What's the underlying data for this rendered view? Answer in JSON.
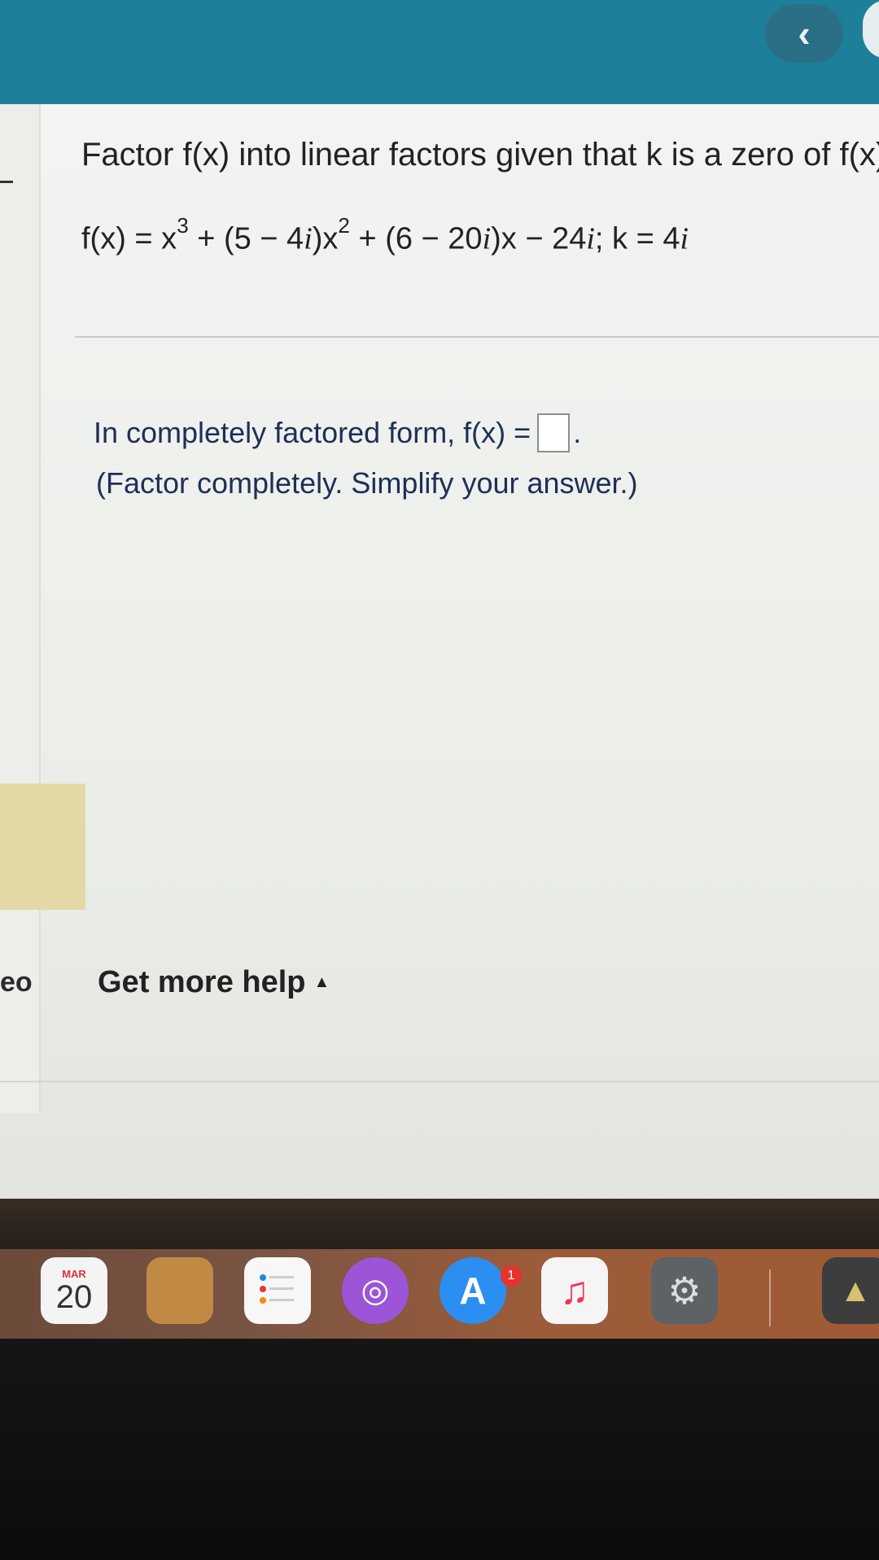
{
  "header": {
    "back_icon": "chevron-left-icon"
  },
  "problem": {
    "title": "Factor f(x) into linear factors given that k is a zero of f(x).",
    "equation": {
      "p1": "f(x) = x",
      "exp1": "3",
      "p2": " + (5 − 4",
      "i1": "i",
      "p3": ")x",
      "exp2": "2",
      "p4": " + (6 − 20",
      "i2": "i",
      "p5": ")x − 24",
      "i3": "i",
      "p6": "; k = 4",
      "i4": "i"
    }
  },
  "answer": {
    "prompt": "In completely factored form, f(x) =",
    "after_box": ".",
    "instruction": "(Factor completely. Simplify your answer.)"
  },
  "help": {
    "label": "Get more help",
    "caret": "▲"
  },
  "left_rail": {
    "partial_text": "eo"
  },
  "dock": {
    "calendar_month": "MAR",
    "calendar_day": "20",
    "appstore_badge": "1",
    "icons": [
      "calendar-icon",
      "notes-icon",
      "reminders-icon",
      "podcasts-icon",
      "app-store-icon",
      "music-icon",
      "system-preferences-icon",
      "rocket-launcher-icon"
    ]
  }
}
